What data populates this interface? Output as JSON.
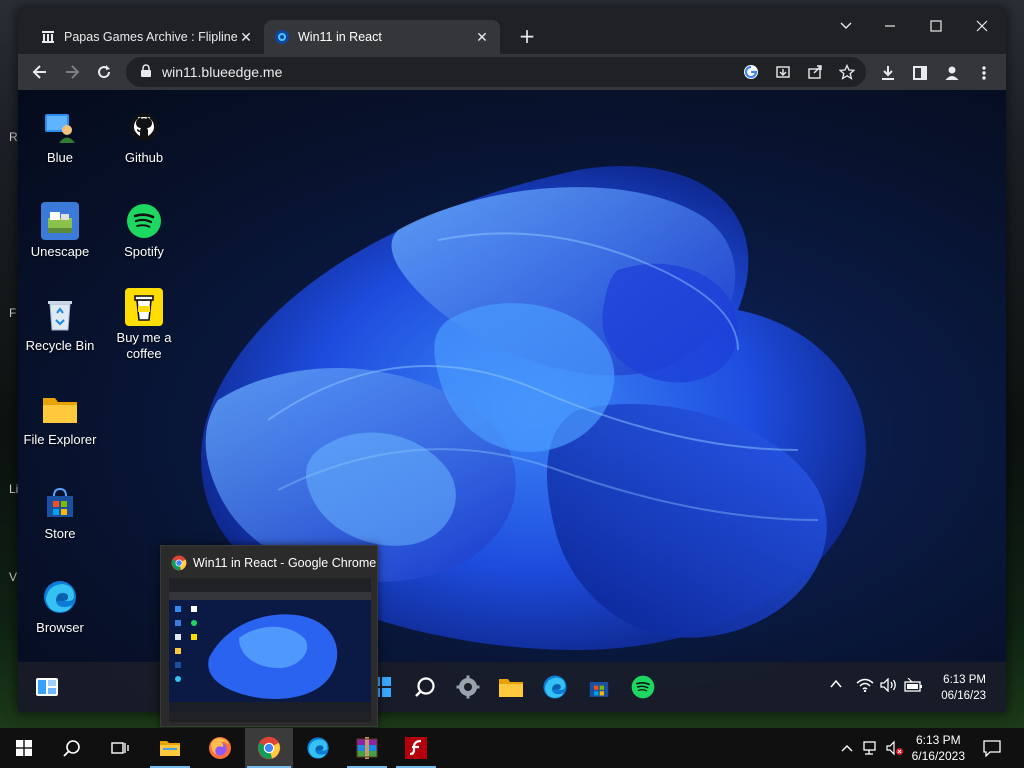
{
  "outer_desktop": {
    "side_letters": [
      "R",
      "F",
      "Li",
      "V"
    ]
  },
  "chrome": {
    "tabs": [
      {
        "title": "Papas Games Archive : Flipline Studios",
        "icon": "archive-icon",
        "active": false
      },
      {
        "title": "Win11 in React",
        "icon": "win11-favicon",
        "active": true
      }
    ],
    "url": "win11.blueedge.me",
    "window_controls": [
      "chevron-down-icon",
      "minimize-icon",
      "maximize-icon",
      "close-icon"
    ]
  },
  "win11": {
    "desktop_icons": [
      {
        "label": "Blue",
        "icon": "user-blue-icon"
      },
      {
        "label": "Github",
        "icon": "github-icon"
      },
      {
        "label": "Unescape",
        "icon": "unescape-icon"
      },
      {
        "label": "Spotify",
        "icon": "spotify-icon"
      },
      {
        "label": "Recycle Bin",
        "icon": "recycle-bin-icon"
      },
      {
        "label": "Buy me a coffee",
        "icon": "coffee-icon"
      },
      {
        "label": "File Explorer",
        "icon": "folder-icon"
      },
      {
        "label": "Store",
        "icon": "store-icon"
      },
      {
        "label": "Browser",
        "icon": "edge-icon"
      }
    ],
    "taskbar_icons": [
      "widgets-icon",
      "start-icon",
      "search-icon",
      "settings-icon",
      "folder-icon",
      "edge-icon",
      "store-icon",
      "spotify-icon"
    ],
    "clock_time": "6:13 PM",
    "clock_date": "06/16/23",
    "accent": "#1e5bff"
  },
  "preview": {
    "title": "Win11 in React - Google Chrome"
  },
  "win10_taskbar": {
    "apps": [
      "start-icon",
      "search-icon",
      "task-view-icon",
      "file-explorer-icon",
      "firefox-icon",
      "chrome-icon",
      "edge-icon",
      "winrar-icon",
      "flash-icon"
    ],
    "clock_time": "6:13 PM",
    "clock_date": "6/16/2023"
  }
}
